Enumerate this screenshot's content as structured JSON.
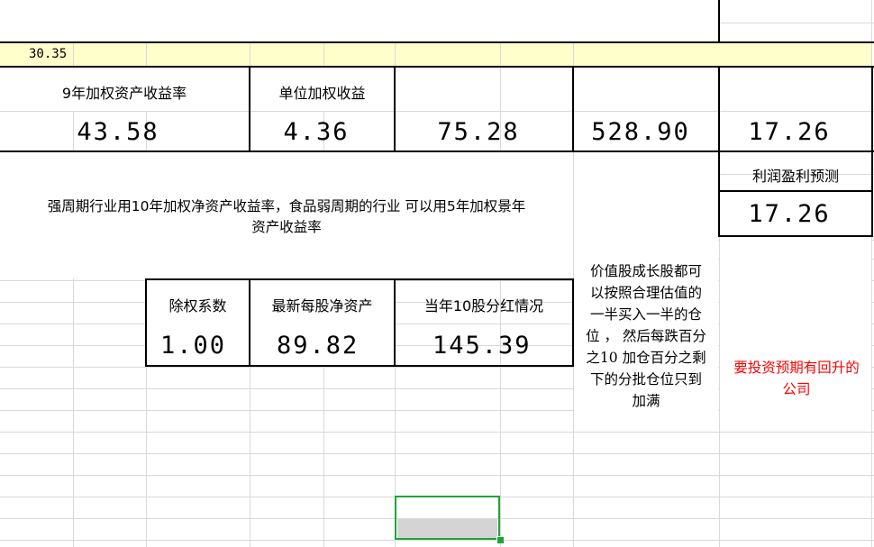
{
  "cells": {
    "top_left_value": "30.35",
    "header_9yr_roe": "9年加权资产收益率",
    "header_unit_earnings": "单位加权收益",
    "val_9yr_roe": "43.58",
    "val_unit_earnings": "4.36",
    "val_c3": "75.28",
    "val_c4": "528.90",
    "val_c5": "17.26",
    "header_profit_forecast": "利润盈利预测",
    "val_profit_forecast": "17.26",
    "note_cycle_line1": "强周期行业用10年加权净资产收益率，食品弱周期的行业 可以用5年加权景年",
    "note_cycle_line2": "资产收益率",
    "header_ex_rights": "除权系数",
    "header_latest_nav": "最新每股净资产",
    "header_dividend": "当年10股分红情况",
    "val_ex_rights": "1.00",
    "val_latest_nav": "89.82",
    "val_dividend": "145.39",
    "note_value_lines": [
      "价值股成长股都可",
      "以按照合理估值的",
      "一半买入一半的仓",
      "位 ， 然后每跌百分",
      "之10 加仓百分之剩",
      "下的分批仓位只到",
      "加满"
    ],
    "note_red_lines": [
      "要投资预期有回升的",
      "公司"
    ]
  },
  "colors": {
    "red_text": "#ff0000",
    "selection": "#21a33a",
    "highlight_row": "#ffffcc"
  }
}
